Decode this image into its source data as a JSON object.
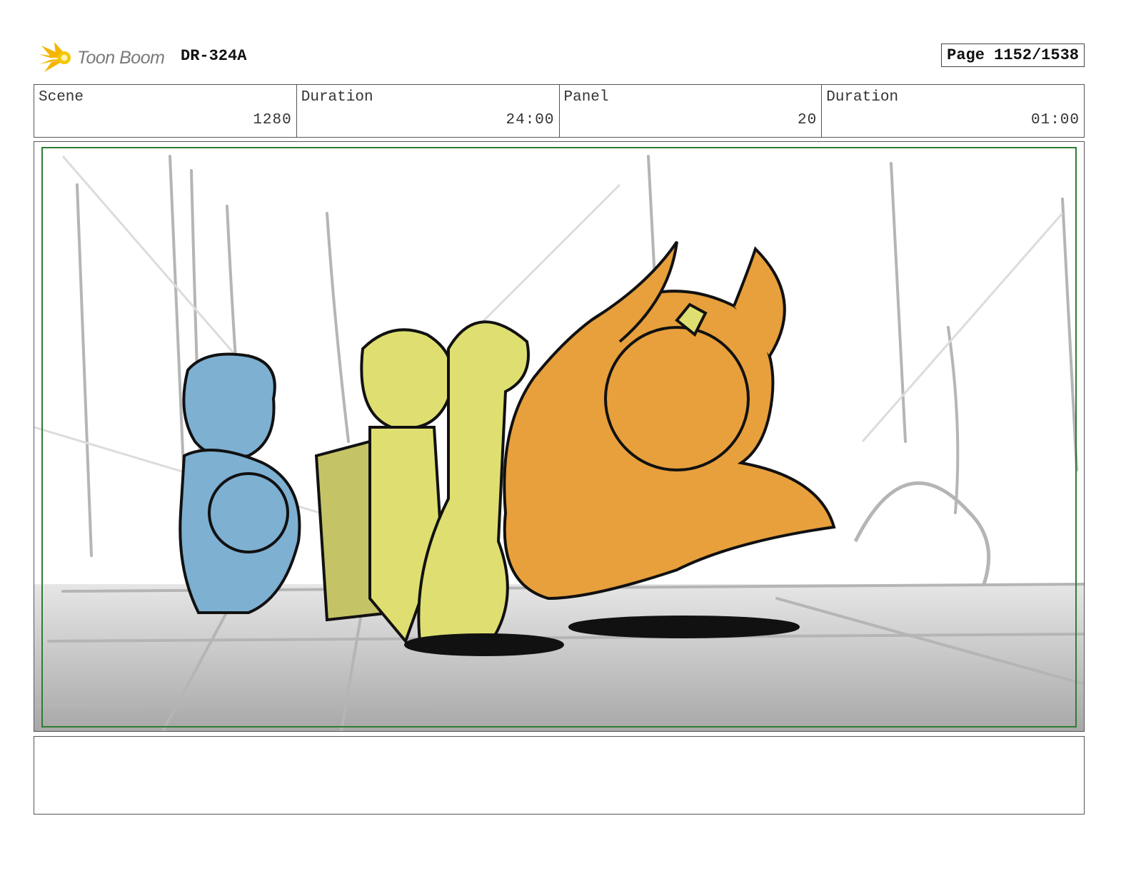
{
  "header": {
    "logo_text": "Toon Boom",
    "project_id": "DR-324A",
    "page_label": "Page 1152/1538"
  },
  "info": {
    "scene_label": "Scene",
    "scene_value": "1280",
    "scene_duration_label": "Duration",
    "scene_duration_value": "24:00",
    "panel_label": "Panel",
    "panel_value": "20",
    "panel_duration_label": "Duration",
    "panel_duration_value": "01:00"
  },
  "notes": {
    "text": ""
  }
}
